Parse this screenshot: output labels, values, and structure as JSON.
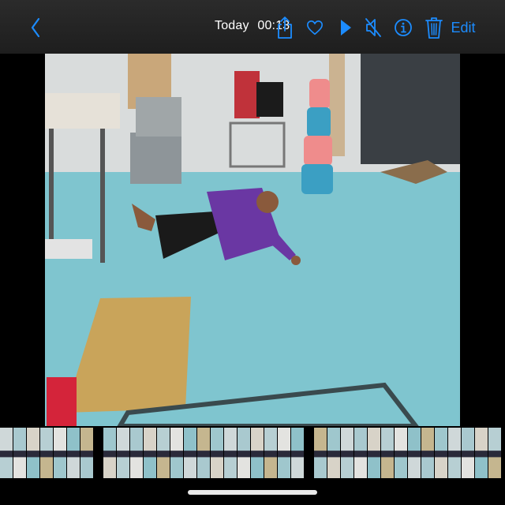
{
  "header": {
    "date_label": "Today",
    "time_label": "00:13",
    "edit_label": "Edit",
    "accent_color": "#1c8cff",
    "icons": [
      "chevron-left-icon",
      "share-icon",
      "heart-icon",
      "play-icon",
      "mute-icon",
      "info-icon",
      "trash-icon"
    ]
  },
  "scrubber": {
    "frame_count": 36
  }
}
